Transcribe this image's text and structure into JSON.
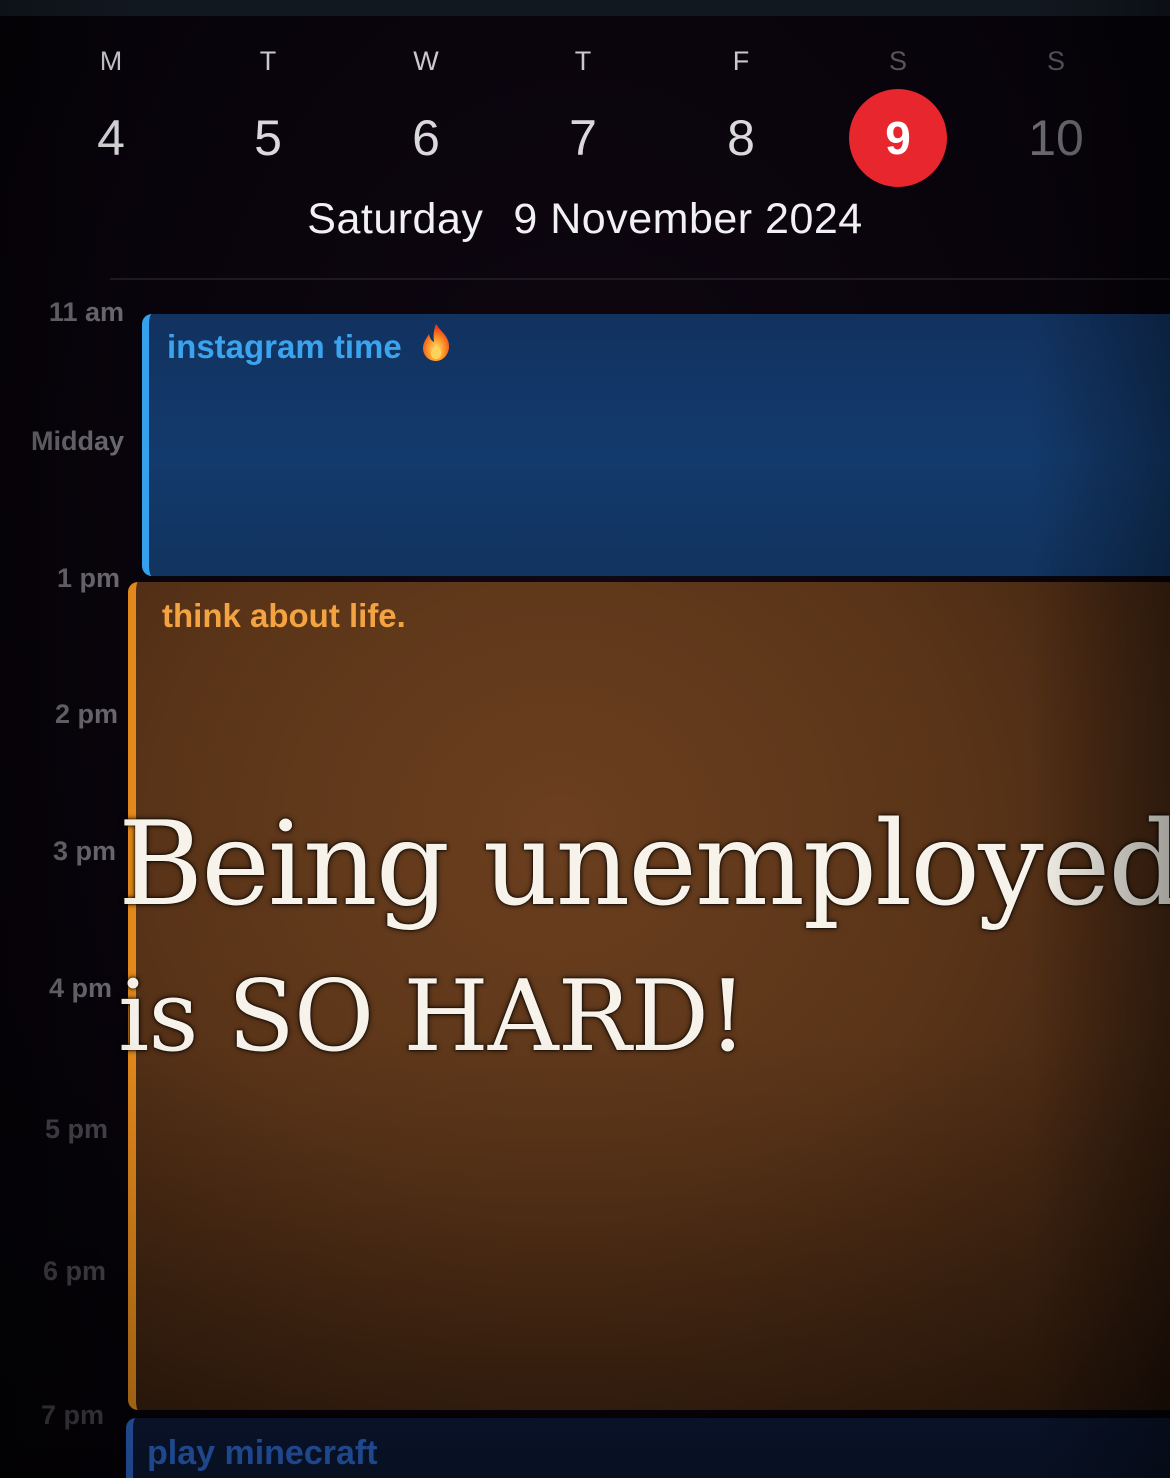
{
  "week": {
    "days": [
      {
        "letter": "M",
        "number": "4"
      },
      {
        "letter": "T",
        "number": "5"
      },
      {
        "letter": "W",
        "number": "6"
      },
      {
        "letter": "T",
        "number": "7"
      },
      {
        "letter": "F",
        "number": "8"
      },
      {
        "letter": "S",
        "number": "9"
      },
      {
        "letter": "S",
        "number": "10"
      }
    ],
    "selected_index": 5,
    "selected_color": "#e7262e"
  },
  "date_header": {
    "weekday": "Saturday",
    "date": "9 November 2024"
  },
  "timeline": {
    "labels": [
      "11 am",
      "Midday",
      "1 pm",
      "2 pm",
      "3 pm",
      "4 pm",
      "5 pm",
      "6 pm",
      "7 pm"
    ]
  },
  "events": [
    {
      "title": "instagram time",
      "icon": "fire-emoji-icon",
      "color": "#35a0ec"
    },
    {
      "title": "think about life.",
      "color": "#e68b1c"
    },
    {
      "title": "play minecraft",
      "color": "#2f69d0"
    }
  ],
  "caption": {
    "line1": "Being unemployed",
    "line2": "is SO HARD!"
  }
}
